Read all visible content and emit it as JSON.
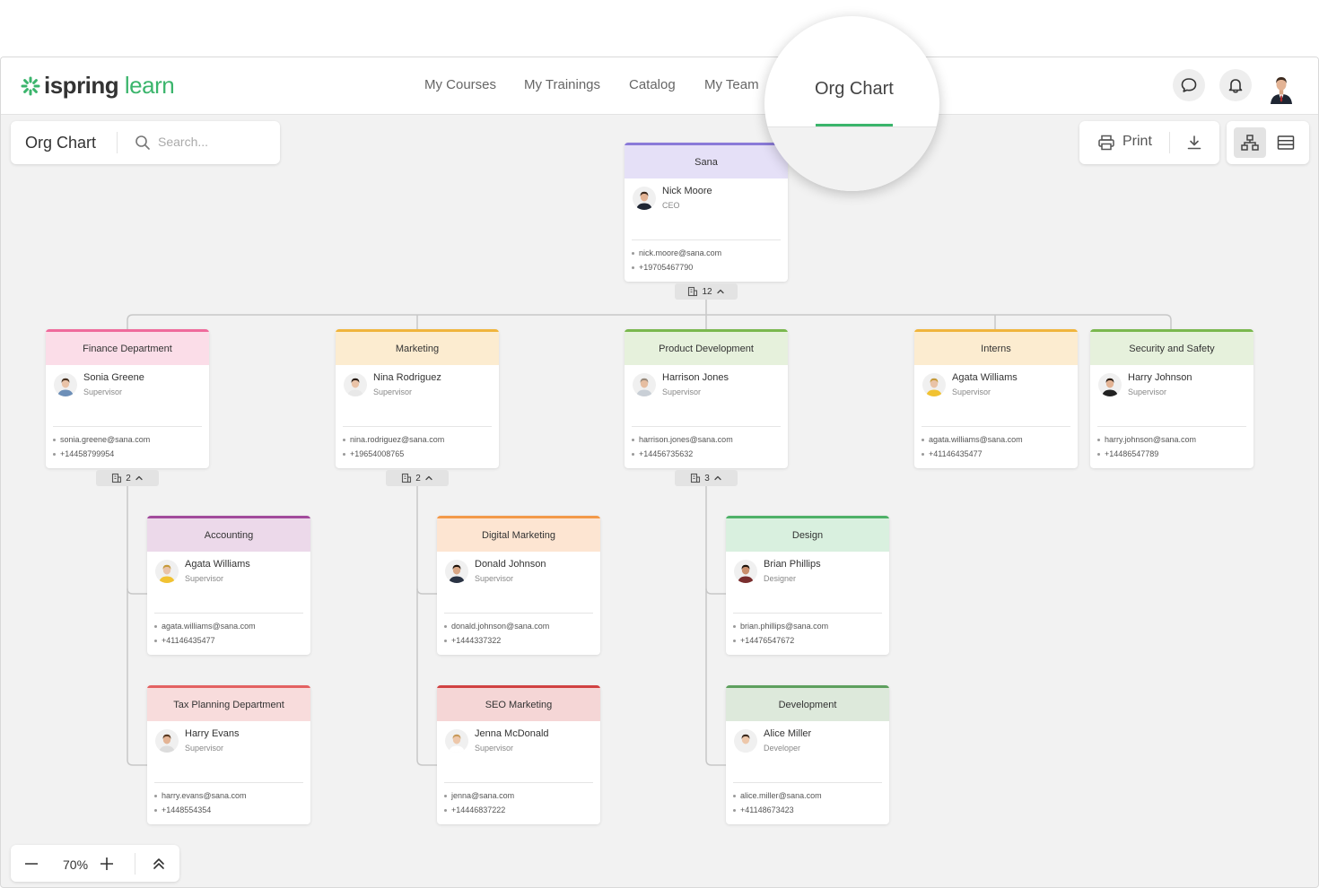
{
  "app": {
    "logo": {
      "word1": "ispring",
      "word2": "learn",
      "icon": "sparkle-logo-icon",
      "color": "#3bb56c"
    },
    "nav": [
      "My Courses",
      "My Trainings",
      "Catalog",
      "My Team",
      "Org Chart"
    ],
    "active_nav": "Org Chart",
    "icons": {
      "chat": "chat-bubble-icon",
      "bell": "bell-icon",
      "avatar": "user-avatar"
    }
  },
  "panel": {
    "title": "Org Chart",
    "search_placeholder": "Search..."
  },
  "toolbar": {
    "print_label": "Print",
    "download_icon": "download-icon",
    "views": [
      "org-chart-view-icon",
      "list-view-icon"
    ]
  },
  "zoom": {
    "level": "70%"
  },
  "cards": [
    {
      "id": "sana",
      "title": "Sana",
      "name": "Nick Moore",
      "role": "CEO",
      "email": "nick.moore@sana.com",
      "phone": "+19705467790",
      "color": "#8a7ad8",
      "bg": "#e5e0f7",
      "badge": "12"
    },
    {
      "id": "finance",
      "title": "Finance Department",
      "name": "Sonia Greene",
      "role": "Supervisor",
      "email": "sonia.greene@sana.com",
      "phone": "+14458799954",
      "color": "#ef6a9b",
      "bg": "#fbdde8",
      "badge": "2"
    },
    {
      "id": "marketing",
      "title": "Marketing",
      "name": "Nina Rodriguez",
      "role": "Supervisor",
      "email": "nina.rodriguez@sana.com",
      "phone": "+19654008765",
      "color": "#f0b53c",
      "bg": "#fcecd0",
      "badge": "2"
    },
    {
      "id": "product",
      "title": "Product Development",
      "name": "Harrison Jones",
      "role": "Supervisor",
      "email": "harrison.jones@sana.com",
      "phone": "+14456735632",
      "color": "#7ab84e",
      "bg": "#e6f1dc",
      "badge": "3"
    },
    {
      "id": "interns",
      "title": "Interns",
      "name": "Agata Williams",
      "role": "Supervisor",
      "email": "agata.williams@sana.com",
      "phone": "+41146435477",
      "color": "#f0b53c",
      "bg": "#fcecd0"
    },
    {
      "id": "security",
      "title": "Security and Safety",
      "name": "Harry Johnson",
      "role": "Supervisor",
      "email": "harry.johnson@sana.com",
      "phone": "+14486547789",
      "color": "#7ab84e",
      "bg": "#e6f1dc"
    },
    {
      "id": "accounting",
      "title": "Accounting",
      "name": "Agata Williams",
      "role": "Supervisor",
      "email": "agata.williams@sana.com",
      "phone": "+41146435477",
      "color": "#a24b9c",
      "bg": "#ecd9ea"
    },
    {
      "id": "tax",
      "title": "Tax Planning Department",
      "name": "Harry Evans",
      "role": "Supervisor",
      "email": "harry.evans@sana.com",
      "phone": "+1448554354",
      "color": "#e36262",
      "bg": "#f8dcdc"
    },
    {
      "id": "digital",
      "title": "Digital Marketing",
      "name": "Donald Johnson",
      "role": "Supervisor",
      "email": "donald.johnson@sana.com",
      "phone": "+1444337322",
      "color": "#f39a4a",
      "bg": "#fde5d2"
    },
    {
      "id": "seo",
      "title": "SEO Marketing",
      "name": "Jenna McDonald",
      "role": "Supervisor",
      "email": "jenna@sana.com",
      "phone": "+14446837222",
      "color": "#d14242",
      "bg": "#f5d6d6"
    },
    {
      "id": "design",
      "title": "Design",
      "name": "Brian Phillips",
      "role": "Designer",
      "email": "brian.phillips@sana.com",
      "phone": "+14476547672",
      "color": "#4fb168",
      "bg": "#d9f0df"
    },
    {
      "id": "development",
      "title": "Development",
      "name": "Alice Miller",
      "role": "Developer",
      "email": "alice.miller@sana.com",
      "phone": "+41148673423",
      "color": "#5ea05e",
      "bg": "#dde9db"
    }
  ]
}
